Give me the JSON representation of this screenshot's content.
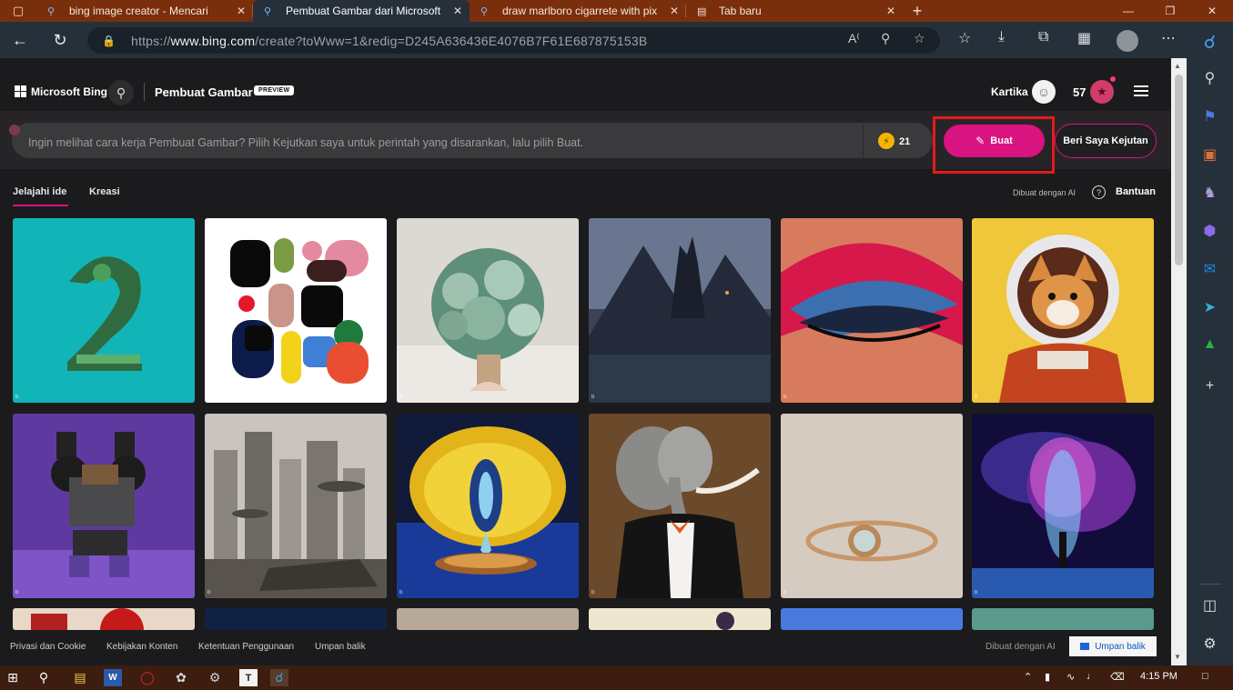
{
  "browser": {
    "tabs": [
      {
        "title": "bing image creator - Mencari",
        "active": false
      },
      {
        "title": "Pembuat Gambar dari Microsoft",
        "active": true
      },
      {
        "title": "draw marlboro cigarrete with pix",
        "active": false
      },
      {
        "title": "Tab baru",
        "active": false
      }
    ],
    "url_prefix": "https://",
    "url_host": "www.bing.com",
    "url_path": "/create?toWww=1&redig=D245A636436E4076B7F61E687875153B"
  },
  "header": {
    "brand": "Microsoft Bing",
    "product": "Pembuat Gambar",
    "preview_badge": "PREVIEW",
    "username": "Kartika",
    "points": "57"
  },
  "prompt": {
    "placeholder": "Ingin melihat cara kerja Pembuat Gambar? Pilih Kejutkan saya untuk perintah yang disarankan, lalu pilih Buat.",
    "boosts": "21",
    "create_label": "Buat",
    "surprise_label": "Beri Saya Kejutan"
  },
  "subnav": {
    "tabs": [
      {
        "label": "Jelajahi ide",
        "active": true
      },
      {
        "label": "Kreasi",
        "active": false
      }
    ],
    "ai_made": "Dibuat dengan AI",
    "help": "Bantuan"
  },
  "gallery": {
    "tile_mark": "b",
    "tiles": [
      {
        "subject": "number-2-leaf-art"
      },
      {
        "subject": "abstract-shapes-poster"
      },
      {
        "subject": "succulent-bouquet"
      },
      {
        "subject": "dark-mountain-castle"
      },
      {
        "subject": "glitter-eye-makeup"
      },
      {
        "subject": "shiba-astronaut"
      },
      {
        "subject": "purple-robot-speakers"
      },
      {
        "subject": "futuristic-city-ships"
      },
      {
        "subject": "lemon-surreal-painting"
      },
      {
        "subject": "elephant-in-tuxedo"
      },
      {
        "subject": "gold-ring"
      },
      {
        "subject": "cosmic-nebula-figure"
      }
    ]
  },
  "footer": {
    "links": [
      "Privasi dan Cookie",
      "Kebijakan Konten",
      "Ketentuan Penggunaan",
      "Umpan balik"
    ],
    "ai_made": "Dibuat dengan AI",
    "feedback_button": "Umpan balik"
  },
  "taskbar": {
    "time": "4:15 PM"
  },
  "colors": {
    "accent": "#d9137f",
    "highlight_box": "#e21b1b",
    "tab_strip": "#7a2f0c",
    "chrome": "#26303a"
  }
}
